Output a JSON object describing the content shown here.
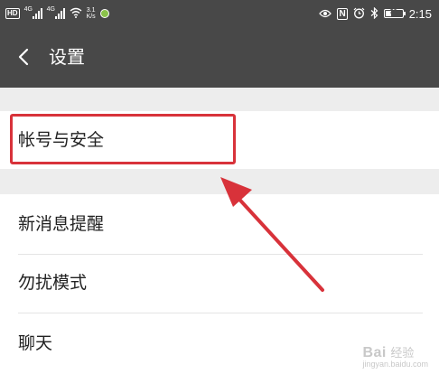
{
  "status_bar": {
    "hd_label": "HD",
    "signal_1_label": "4G",
    "signal_2_label": "4G",
    "wifi_icon": "wifi-icon",
    "speed_value": "3.1",
    "speed_unit": "K/s",
    "nfc_label": "N",
    "battery_level": "30",
    "time": "2:15",
    "icons": [
      "eye-icon",
      "nfc-icon",
      "alarm-icon",
      "bluetooth-icon",
      "battery-icon"
    ]
  },
  "header": {
    "title": "设置",
    "back_icon": "chevron-left-icon",
    "background": "#484848"
  },
  "settings": {
    "items": [
      {
        "label": "帐号与安全"
      },
      {
        "label": "新消息提醒"
      },
      {
        "label": "勿扰模式"
      },
      {
        "label": "聊天"
      }
    ]
  },
  "annotation": {
    "highlight_color": "#d8323a",
    "arrow_icon": "arrow-up-left-icon"
  },
  "watermark": {
    "logo": "Bai",
    "text": "经验",
    "url": "jingyan.baidu.com"
  }
}
